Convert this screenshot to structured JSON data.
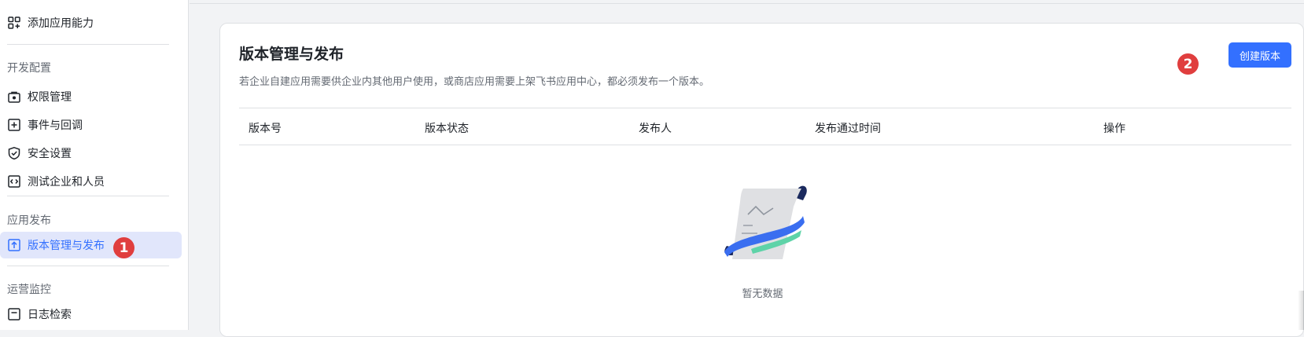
{
  "sidebar": {
    "add_capability": "添加应用能力",
    "sections": {
      "dev_config": "开发配置",
      "app_publish": "应用发布",
      "ops_monitor": "运营监控"
    },
    "items": {
      "permissions": "权限管理",
      "events": "事件与回调",
      "security": "安全设置",
      "test_org": "测试企业和人员",
      "version_release": "版本管理与发布",
      "log_search": "日志检索"
    }
  },
  "main": {
    "title": "版本管理与发布",
    "description": "若企业自建应用需要供企业内其他用户使用，或商店应用需要上架飞书应用中心，都必须发布一个版本。",
    "create_button": "创建版本",
    "table": {
      "columns": [
        "版本号",
        "版本状态",
        "发布人",
        "发布通过时间",
        "操作"
      ]
    },
    "empty_text": "暂无数据"
  },
  "markers": {
    "one": "1",
    "two": "2"
  },
  "colors": {
    "accent": "#3370ff",
    "marker": "#e03e3e",
    "active_bg": "#e1e6fb"
  },
  "icons": {
    "add_capability": "grid-plus-icon",
    "permissions": "lock-box-icon",
    "events": "plus-square-icon",
    "security": "shield-check-icon",
    "test_org": "code-square-icon",
    "version_release": "upload-square-icon",
    "log_search": "log-icon",
    "empty": "empty-document-illustration"
  }
}
